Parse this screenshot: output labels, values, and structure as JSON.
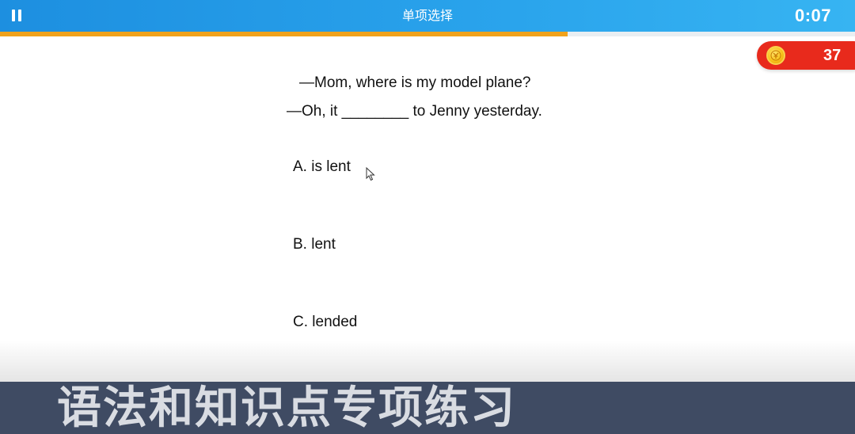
{
  "header": {
    "title": "单项选择",
    "timer": "0:07",
    "pause_icon": "pause-icon"
  },
  "progress": {
    "fraction": 0.664,
    "color": "#f0a21c"
  },
  "score": {
    "value": "37",
    "icon": "coin-icon",
    "color": "#e82a1c"
  },
  "question": {
    "line1": "—Mom, where is my model plane?",
    "line2": "—Oh, it ________ to Jenny yesterday."
  },
  "options": [
    {
      "label": "A. is lent"
    },
    {
      "label": "B. lent"
    },
    {
      "label": "C. lended"
    }
  ],
  "banner": {
    "text": "语法和知识点专项练习"
  },
  "colors": {
    "header": "#1d8fe0",
    "banner": "#3f4b63"
  }
}
